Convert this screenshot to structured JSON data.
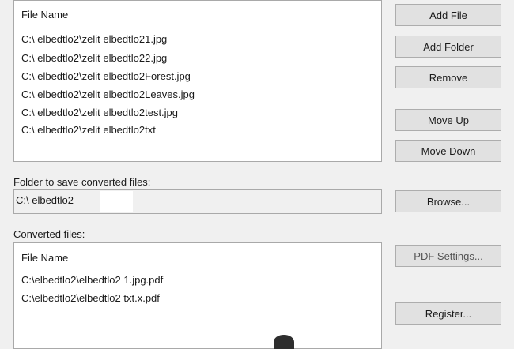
{
  "source_list": {
    "header": "File Name",
    "items": [
      "C:\\ elbedtlo2\\zelit elbedtlo21.jpg",
      "C:\\ elbedtlo2\\zelit elbedtlo22.jpg",
      "C:\\ elbedtlo2\\zelit elbedtlo2Forest.jpg",
      "C:\\ elbedtlo2\\zelit elbedtlo2Leaves.jpg",
      "C:\\ elbedtlo2\\zelit elbedtlo2test.jpg",
      "C:\\ elbedtlo2\\zelit elbedtlo2txt"
    ]
  },
  "buttons": {
    "add_file": "Add File",
    "add_folder": "Add Folder",
    "remove": "Remove",
    "move_up": "Move Up",
    "move_down": "Move Down",
    "browse": "Browse...",
    "pdf_settings": "PDF Settings...",
    "register": "Register..."
  },
  "output_folder": {
    "label": "Folder to save converted files:",
    "value": "C:\\ elbedtlo2"
  },
  "converted_list": {
    "label": "Converted files:",
    "header": "File Name",
    "items": [
      "C:\\elbedtlo2\\elbedtlo2 1.jpg.pdf",
      "C:\\elbedtlo2\\elbedtlo2 txt.x.pdf"
    ]
  }
}
